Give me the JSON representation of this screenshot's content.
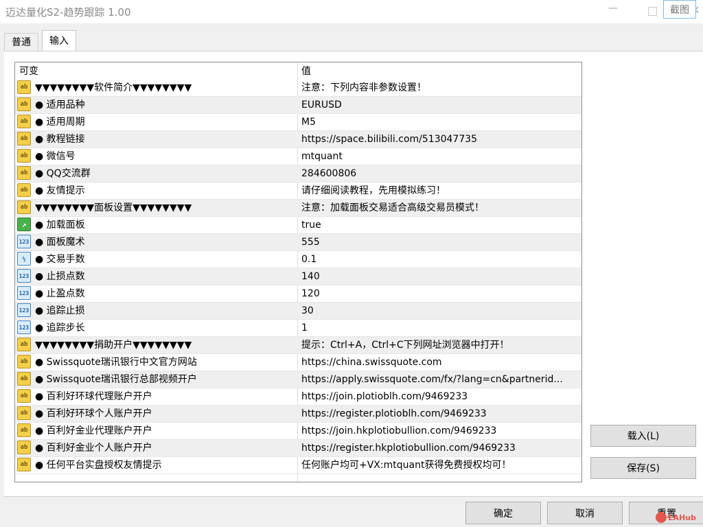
{
  "window": {
    "title": "迈达量化S2-趋势跟踪 1.00",
    "min_glyph": "—",
    "close_glyph": "✕",
    "capture_label": "截图"
  },
  "tabs": [
    {
      "label": "普通"
    },
    {
      "label": "输入"
    }
  ],
  "grid": {
    "headers": {
      "name": "可变",
      "value": "值"
    },
    "rows": [
      {
        "icon": "string-icon",
        "name": "▼▼▼▼▼▼▼▼软件简介▼▼▼▼▼▼▼▼",
        "value": "注意：下列内容非参数设置！"
      },
      {
        "icon": "string-icon",
        "name": "● 适用品种",
        "value": "EURUSD"
      },
      {
        "icon": "string-icon",
        "name": "● 适用周期",
        "value": "M5"
      },
      {
        "icon": "string-icon",
        "name": "● 教程链接",
        "value": "https://space.bilibili.com/513047735"
      },
      {
        "icon": "string-icon",
        "name": "● 微信号",
        "value": "mtquant"
      },
      {
        "icon": "string-icon",
        "name": "● QQ交流群",
        "value": "284600806"
      },
      {
        "icon": "string-icon",
        "name": "● 友情提示",
        "value": "请仔细阅读教程，先用模拟练习！"
      },
      {
        "icon": "string-icon",
        "name": "▼▼▼▼▼▼▼▼面板设置▼▼▼▼▼▼▼▼",
        "value": "注意：加载面板交易适合高级交易员模式！"
      },
      {
        "icon": "bool-icon",
        "name": "● 加载面板",
        "value": "true"
      },
      {
        "icon": "integer-icon",
        "name": "● 面板魔术",
        "value": "555"
      },
      {
        "icon": "fraction-icon",
        "name": "● 交易手数",
        "value": "0.1"
      },
      {
        "icon": "integer-icon",
        "name": "● 止损点数",
        "value": "140"
      },
      {
        "icon": "integer-icon",
        "name": "● 止盈点数",
        "value": "120"
      },
      {
        "icon": "integer-icon",
        "name": "● 追踪止损",
        "value": "30"
      },
      {
        "icon": "integer-icon",
        "name": "● 追踪步长",
        "value": "1"
      },
      {
        "icon": "string-icon",
        "name": "▼▼▼▼▼▼▼▼捐助开户▼▼▼▼▼▼▼▼",
        "value": "提示：Ctrl+A，Ctrl+C下列网址浏览器中打开！"
      },
      {
        "icon": "string-icon",
        "name": "● Swissquote瑞讯银行中文官方网站",
        "value": "https://china.swissquote.com"
      },
      {
        "icon": "string-icon",
        "name": "● Swissquote瑞讯银行总部视频开户",
        "value": "https://apply.swissquote.com/fx/?lang=cn&partnerid..."
      },
      {
        "icon": "string-icon",
        "name": "● 百利好环球代理账户开户",
        "value": "https://join.plotioblh.com/9469233"
      },
      {
        "icon": "string-icon",
        "name": "● 百利好环球个人账户开户",
        "value": "https://register.plotioblh.com/9469233"
      },
      {
        "icon": "string-icon",
        "name": "● 百利好金业代理账户开户",
        "value": "https://join.hkplotiobullion.com/9469233"
      },
      {
        "icon": "string-icon",
        "name": "● 百利好金业个人账户开户",
        "value": "https://register.hkplotiobullion.com/9469233"
      },
      {
        "icon": "string-icon",
        "name": "● 任何平台实盘授权友情提示",
        "value": "任何账户均可+VX:mtquant获得免费授权均可！"
      }
    ]
  },
  "icons": {
    "string": "ab",
    "bool": "↗",
    "integer": "123",
    "fraction": "½"
  },
  "buttons": {
    "load": "载入(L)",
    "save": "保存(S)",
    "ok": "确定",
    "cancel": "取消",
    "reset": "重置"
  },
  "watermark": {
    "text": "EAHub"
  }
}
